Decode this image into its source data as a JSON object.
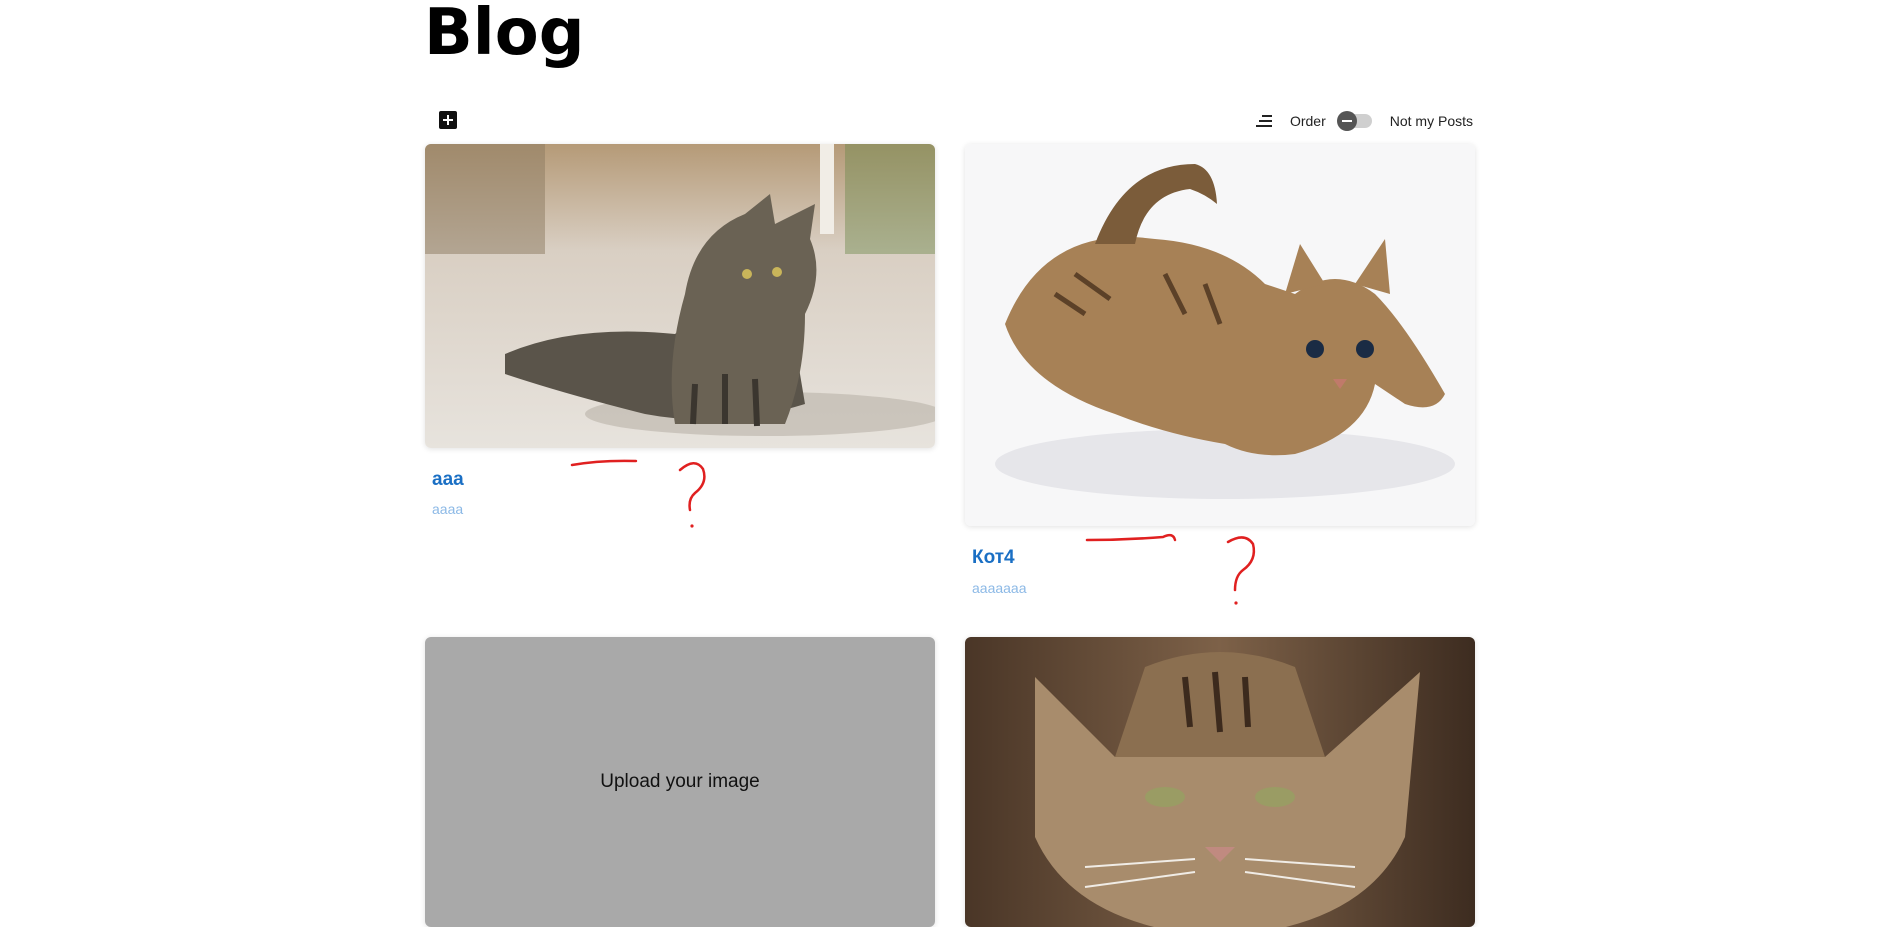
{
  "page": {
    "title": "Blog"
  },
  "toolbar": {
    "add_icon": "plus-square-icon",
    "sort_icon": "sort-lines-icon",
    "order_label": "Order",
    "not_my_posts_label": "Not my Posts",
    "toggle_on": false
  },
  "posts": [
    {
      "title": "aaa",
      "description": "aaaa",
      "image": "photo-tabby-cat-lying"
    },
    {
      "title": "Кот4",
      "description": "aaaaaaa",
      "image": "photo-tabby-kitten-crouching"
    },
    {
      "title": "",
      "description": "",
      "image": "upload-placeholder",
      "upload_label": "Upload your image"
    },
    {
      "title": "",
      "description": "",
      "image": "photo-grumpy-cat-face"
    }
  ],
  "colors": {
    "title_link": "#1a6fc4",
    "description": "#8cb9e6",
    "upload_bg": "#a9a9a9",
    "annotation": "#e02020"
  }
}
